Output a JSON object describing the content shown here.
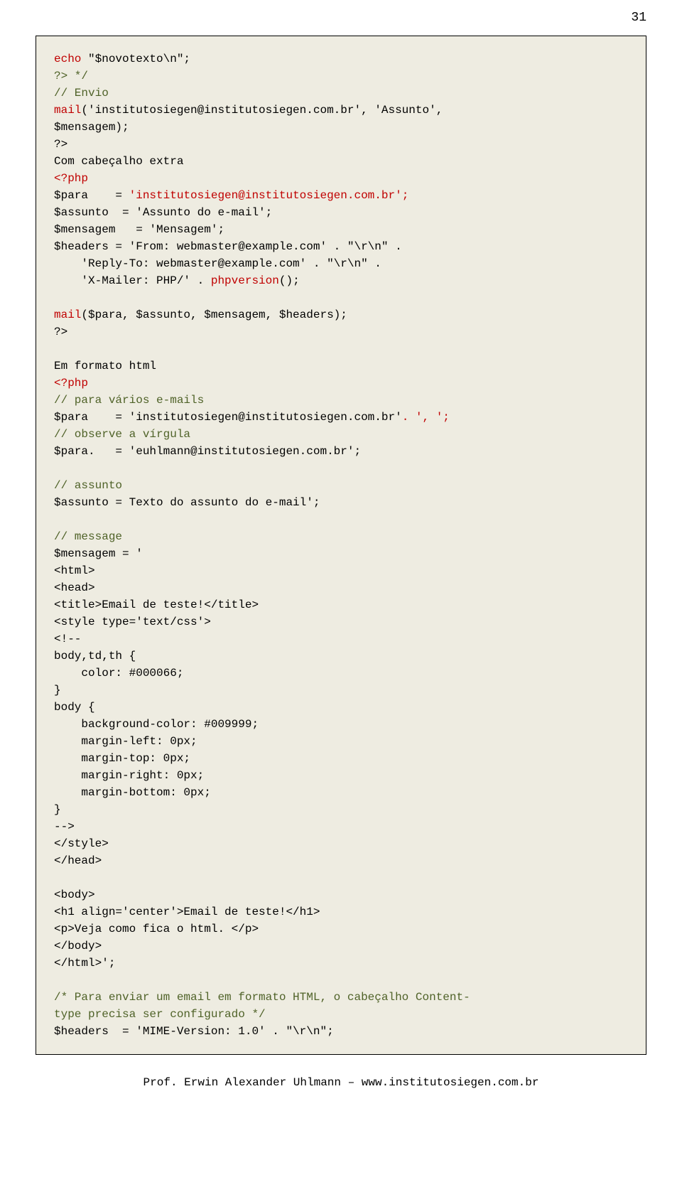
{
  "page_number": "31",
  "footer": "Prof. Erwin Alexander Uhlmann – www.institutosiegen.com.br",
  "code": {
    "l01": "echo",
    "l01b": " \"$novotexto\\n\";",
    "l02": "?> */",
    "l03": "// Envio",
    "l04a": "mail",
    "l04b": "('institutosiegen@institutosiegen.com.br', 'Assunto',",
    "l05": "$mensagem);",
    "l06": "?>",
    "l07": "Com cabeçalho extra",
    "l08": "<?php",
    "l09a": "$para    = ",
    "l09b": "'institutosiegen@institutosiegen.com.br';",
    "l10": "$assunto  = 'Assunto do e-mail';",
    "l11": "$mensagem   = 'Mensagem';",
    "l12": "$headers = 'From: webmaster@example.com' . \"\\r\\n\" .",
    "l13": "    'Reply-To: webmaster@example.com' . \"\\r\\n\" .",
    "l14a": "    'X-Mailer: PHP/' . ",
    "l14b": "phpversion",
    "l14c": "();",
    "l15a": "mail",
    "l15b": "($para, $assunto, $mensagem, $headers);",
    "l16": "?>",
    "l17": "Em formato html",
    "l18": "<?php",
    "l19": "// para vários e-mails",
    "l20a": "$para    = 'institutosiegen@institutosiegen.com.br'",
    "l20b": ". ', ';",
    "l21": "// observe a vírgula",
    "l22": "$para.   = 'euhlmann@institutosiegen.com.br';",
    "l23": "// assunto",
    "l24": "$assunto = Texto do assunto do e-mail';",
    "l25": "// message",
    "l26": "$mensagem = '",
    "l27": "<html>",
    "l28": "<head>",
    "l29": "<title>Email de teste!</title>",
    "l30": "<style type='text/css'>",
    "l31": "<!--",
    "l32": "body,td,th {",
    "l33": "    color: #000066;",
    "l34": "}",
    "l35": "body {",
    "l36": "    background-color: #009999;",
    "l37": "    margin-left: 0px;",
    "l38": "    margin-top: 0px;",
    "l39": "    margin-right: 0px;",
    "l40": "    margin-bottom: 0px;",
    "l41": "}",
    "l42": "-->",
    "l43": "</style>",
    "l44": "</head>",
    "l45": "<body>",
    "l46": "<h1 align='center'>Email de teste!</h1>",
    "l47": "<p>Veja como fica o html. </p>",
    "l48": "</body>",
    "l49": "</html>';",
    "l50": "/* Para enviar um email em formato HTML, o cabeçalho Content-",
    "l51": "type precisa ser configurado */",
    "l52": "$headers  = 'MIME-Version: 1.0' . \"\\r\\n\";"
  }
}
